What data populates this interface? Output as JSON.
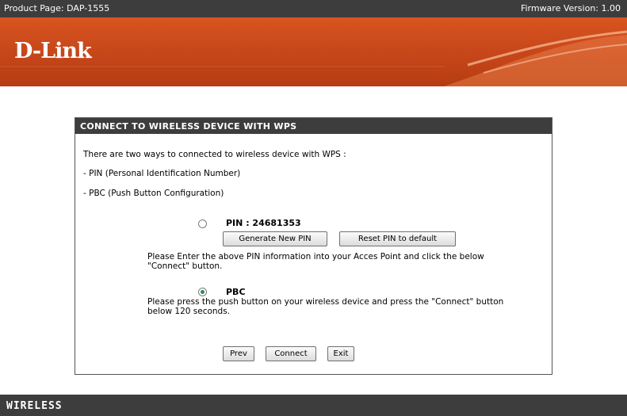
{
  "header": {
    "product_page": "Product Page: DAP-1555",
    "firmware_version": "Firmware Version: 1.00",
    "logo_text": "D-Link",
    "accent_color": "#c9481b"
  },
  "panel": {
    "title": "CONNECT TO WIRELESS DEVICE WITH WPS",
    "intro": "There are two ways to connected to wireless device with WPS :",
    "method_pin": "- PIN (Personal Identification Number)",
    "method_pbc": "- PBC (Push Button Configuration)",
    "pin_option": {
      "label": "PIN : 24681353",
      "selected": false,
      "generate_button": "Generate New PIN",
      "reset_button": "Reset PIN to default",
      "instruction_line1": "Please Enter the above PIN information into your Acces Point and click the below",
      "instruction_line2": "\"Connect\" button."
    },
    "pbc_option": {
      "label": "PBC",
      "selected": true,
      "instruction_line1": "Please press the push button on your wireless device and press the \"Connect\" button",
      "instruction_line2": "below 120 seconds."
    },
    "buttons": {
      "prev": "Prev",
      "connect": "Connect",
      "exit": "Exit"
    }
  },
  "footer": {
    "label": "WIRELESS"
  }
}
